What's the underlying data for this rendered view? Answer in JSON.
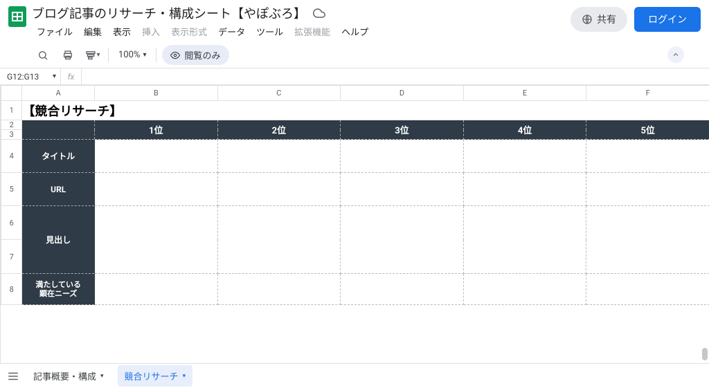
{
  "doc_title": "ブログ記事のリサーチ・構成シート【やぽぶろ】",
  "menu": {
    "file": "ファイル",
    "edit": "編集",
    "view": "表示",
    "insert": "挿入",
    "format": "表示形式",
    "data": "データ",
    "tools": "ツール",
    "extensions": "拡張機能",
    "help": "ヘルプ"
  },
  "header_buttons": {
    "share": "共有",
    "login": "ログイン"
  },
  "toolbar": {
    "zoom": "100%",
    "view_only": "閲覧のみ"
  },
  "namebox": "G12:G13",
  "columns": [
    "A",
    "B",
    "C",
    "D",
    "E",
    "F"
  ],
  "row_numbers": [
    "1",
    "2",
    "3",
    "4",
    "5",
    "6",
    "7",
    "8"
  ],
  "content": {
    "section_title": "【競合リサーチ】",
    "rank_headers": [
      "1位",
      "2位",
      "3位",
      "4位",
      "5位"
    ],
    "side_labels": {
      "title": "タイトル",
      "url": "URL",
      "headings": "見出し",
      "needs_line1": "満たしている",
      "needs_line2": "顕在ニーズ"
    }
  },
  "tabs": {
    "tab1": "記事概要・構成",
    "tab2": "競合リサーチ"
  }
}
